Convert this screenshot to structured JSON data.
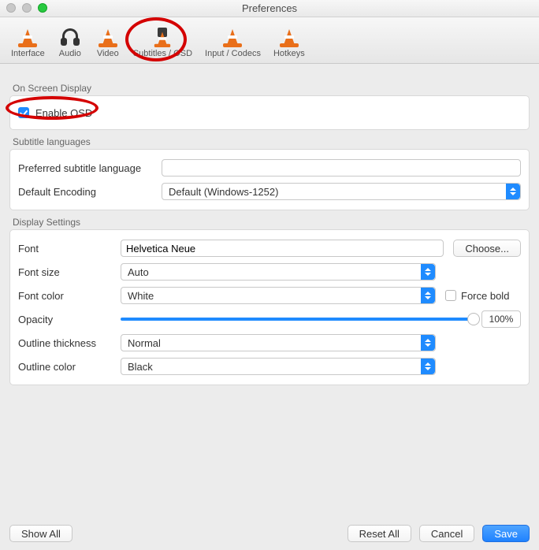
{
  "window": {
    "title": "Preferences"
  },
  "toolbar": {
    "items": [
      {
        "label": "Interface"
      },
      {
        "label": "Audio"
      },
      {
        "label": "Video"
      },
      {
        "label": "Subtitles / OSD"
      },
      {
        "label": "Input / Codecs"
      },
      {
        "label": "Hotkeys"
      }
    ]
  },
  "osd": {
    "section_label": "On Screen Display",
    "enable_label": "Enable OSD",
    "enabled": true
  },
  "subs": {
    "section_label": "Subtitle languages",
    "preferred_label": "Preferred subtitle language",
    "preferred_value": "",
    "encoding_label": "Default Encoding",
    "encoding_value": "Default (Windows-1252)"
  },
  "display": {
    "section_label": "Display Settings",
    "font_label": "Font",
    "font_value": "Helvetica Neue",
    "choose_label": "Choose...",
    "size_label": "Font size",
    "size_value": "Auto",
    "color_label": "Font color",
    "color_value": "White",
    "force_bold_label": "Force bold",
    "force_bold_checked": false,
    "opacity_label": "Opacity",
    "opacity_value": "100%",
    "thickness_label": "Outline thickness",
    "thickness_value": "Normal",
    "outline_color_label": "Outline color",
    "outline_color_value": "Black"
  },
  "footer": {
    "show_all": "Show All",
    "reset_all": "Reset All",
    "cancel": "Cancel",
    "save": "Save"
  }
}
